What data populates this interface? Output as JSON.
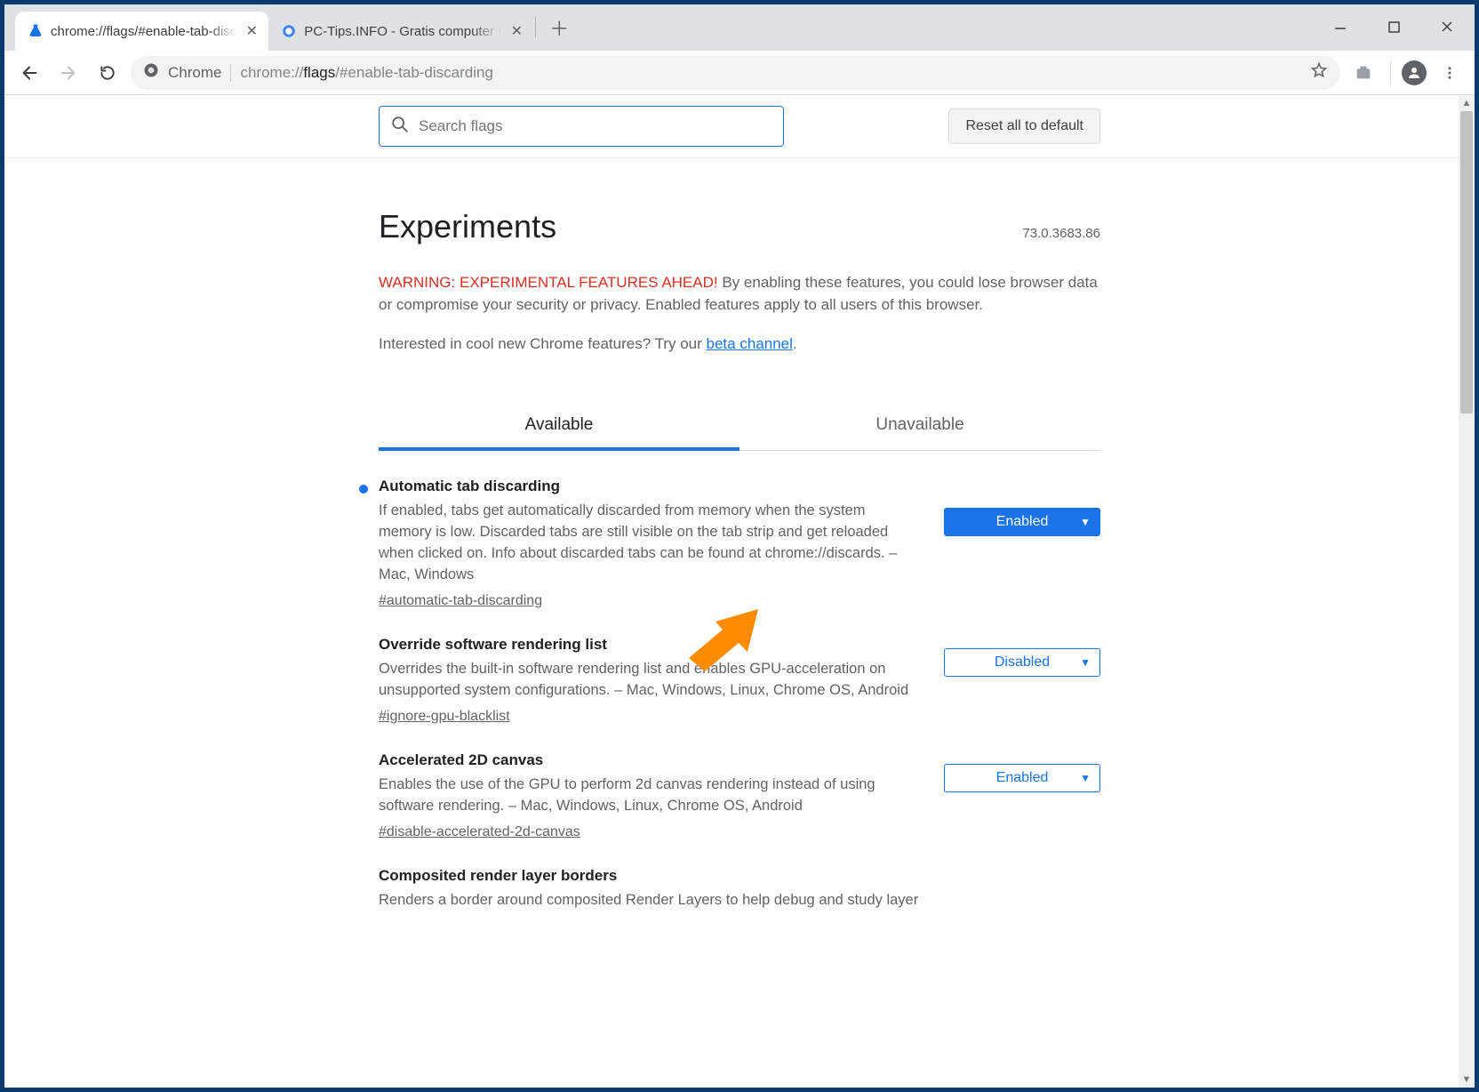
{
  "window": {
    "tabs": [
      {
        "title": "chrome://flags/#enable-tab-disc",
        "active": true,
        "favicon": "flask-icon"
      },
      {
        "title": "PC-Tips.INFO - Gratis computer t",
        "active": false,
        "favicon": "globe-icon"
      }
    ]
  },
  "toolbar": {
    "chip": "Chrome",
    "url_prefix": "chrome://",
    "url_bold": "flags",
    "url_suffix": "/#enable-tab-discarding"
  },
  "flags_page": {
    "search_placeholder": "Search flags",
    "reset_label": "Reset all to default",
    "heading": "Experiments",
    "version": "73.0.3683.86",
    "warning_label": "WARNING: EXPERIMENTAL FEATURES AHEAD!",
    "warning_text": "By enabling these features, you could lose browser data or compromise your security or privacy. Enabled features apply to all users of this browser.",
    "interest_text": "Interested in cool new Chrome features? Try our ",
    "interest_link": "beta channel",
    "tabs": {
      "available": "Available",
      "unavailable": "Unavailable"
    },
    "items": [
      {
        "title": "Automatic tab discarding",
        "desc": "If enabled, tabs get automatically discarded from memory when the system memory is low. Discarded tabs are still visible on the tab strip and get reloaded when clicked on. Info about discarded tabs can be found at chrome://discards. – Mac, Windows",
        "anchor": "#automatic-tab-discarding",
        "state": "Enabled",
        "filled": true,
        "modified": true
      },
      {
        "title": "Override software rendering list",
        "desc": "Overrides the built-in software rendering list and enables GPU-acceleration on unsupported system configurations. – Mac, Windows, Linux, Chrome OS, Android",
        "anchor": "#ignore-gpu-blacklist",
        "state": "Disabled",
        "filled": false,
        "modified": false
      },
      {
        "title": "Accelerated 2D canvas",
        "desc": "Enables the use of the GPU to perform 2d canvas rendering instead of using software rendering. – Mac, Windows, Linux, Chrome OS, Android",
        "anchor": "#disable-accelerated-2d-canvas",
        "state": "Enabled",
        "filled": false,
        "modified": false
      },
      {
        "title": "Composited render layer borders",
        "desc": "Renders a border around composited Render Layers to help debug and study layer",
        "anchor": "",
        "state": "",
        "filled": false,
        "modified": false
      }
    ]
  }
}
